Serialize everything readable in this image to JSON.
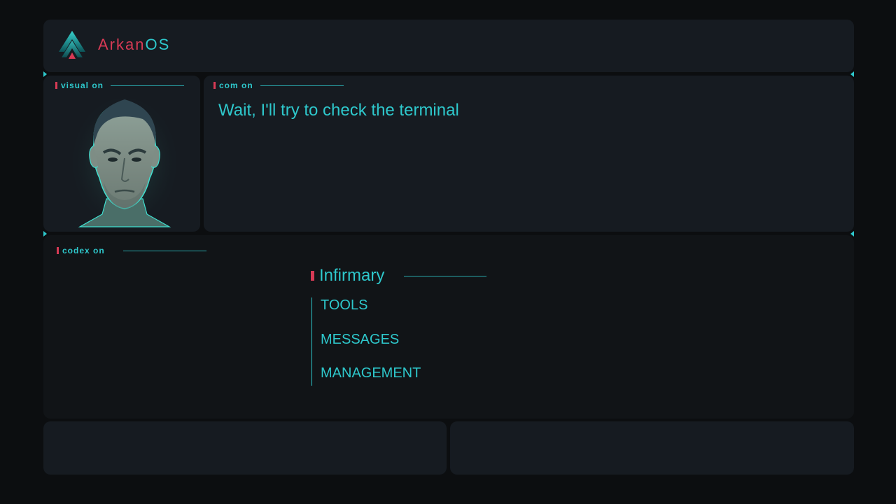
{
  "brand": {
    "name_part1": "Arkan",
    "name_part2": "OS"
  },
  "panels": {
    "visual": {
      "tag": "visual on"
    },
    "com": {
      "tag": "com on",
      "message": "Wait, I'll try to check the terminal"
    },
    "codex": {
      "tag": "codex on",
      "section_title": "Infirmary",
      "menu": [
        {
          "label": "TOOLS"
        },
        {
          "label": "MESSAGES"
        },
        {
          "label": "MANAGEMENT"
        }
      ]
    }
  },
  "colors": {
    "accent": "#2ec8cc",
    "brand_red": "#d83a55",
    "panel": "#161b21",
    "background": "#0c0e10"
  },
  "icons": [
    "arkanos-logo-icon",
    "character-portrait"
  ]
}
